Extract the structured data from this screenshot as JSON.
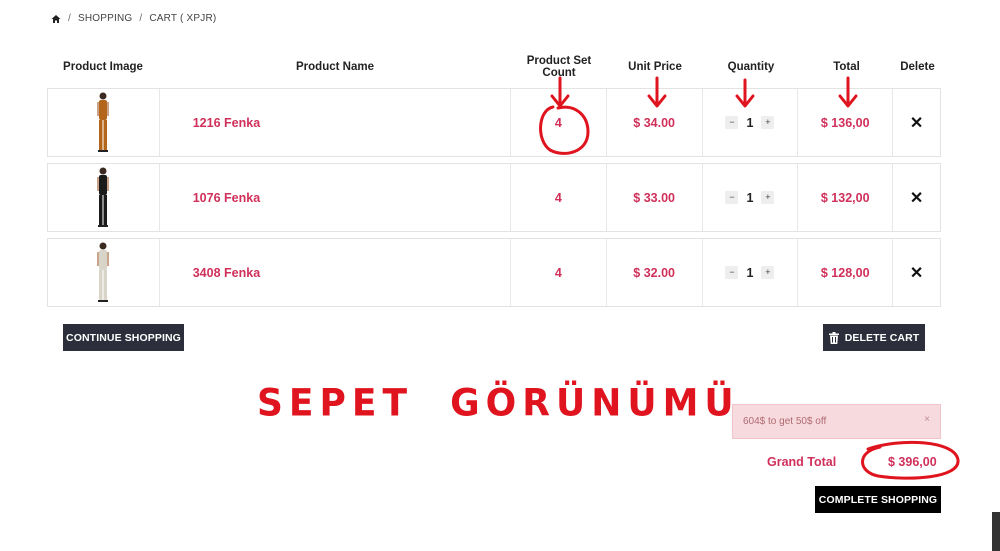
{
  "breadcrumb": {
    "home_icon": "home-icon",
    "items": [
      "SHOPPING",
      "CART ( XPJR)"
    ]
  },
  "table": {
    "headers": [
      "Product Image",
      "Product Name",
      "Product Set Count",
      "Unit Price",
      "Quantity",
      "Total",
      "Delete"
    ],
    "rows": [
      {
        "name": "1216 Fenka",
        "set_count": "4",
        "unit_price": "$ 34.00",
        "quantity": "1",
        "total": "$ 136,00",
        "figure_color": "#b4651c"
      },
      {
        "name": "1076 Fenka",
        "set_count": "4",
        "unit_price": "$ 33.00",
        "quantity": "1",
        "total": "$ 132,00",
        "figure_color": "#1a1a1a"
      },
      {
        "name": "3408 Fenka",
        "set_count": "4",
        "unit_price": "$ 32.00",
        "quantity": "1",
        "total": "$ 128,00",
        "figure_color": "#d8d4c8"
      }
    ],
    "qty_minus": "−",
    "qty_plus": "+",
    "delete_symbol": "✕"
  },
  "buttons": {
    "continue": "CONTINUE SHOPPING",
    "delete_cart": "DELETE CART",
    "complete": "COMPLETE SHOPPING"
  },
  "overlay_title": "SEPET  GÖRÜNÜMÜ",
  "promo": {
    "text": "604$ to get 50$ off",
    "close": "×"
  },
  "grand_total": {
    "label": "Grand Total",
    "value": "$ 396,00"
  },
  "colors": {
    "accent": "#d0305a",
    "dark_button": "#2c2f3b",
    "annotation": "#e0141e",
    "promo_bg": "#f6dadd"
  }
}
